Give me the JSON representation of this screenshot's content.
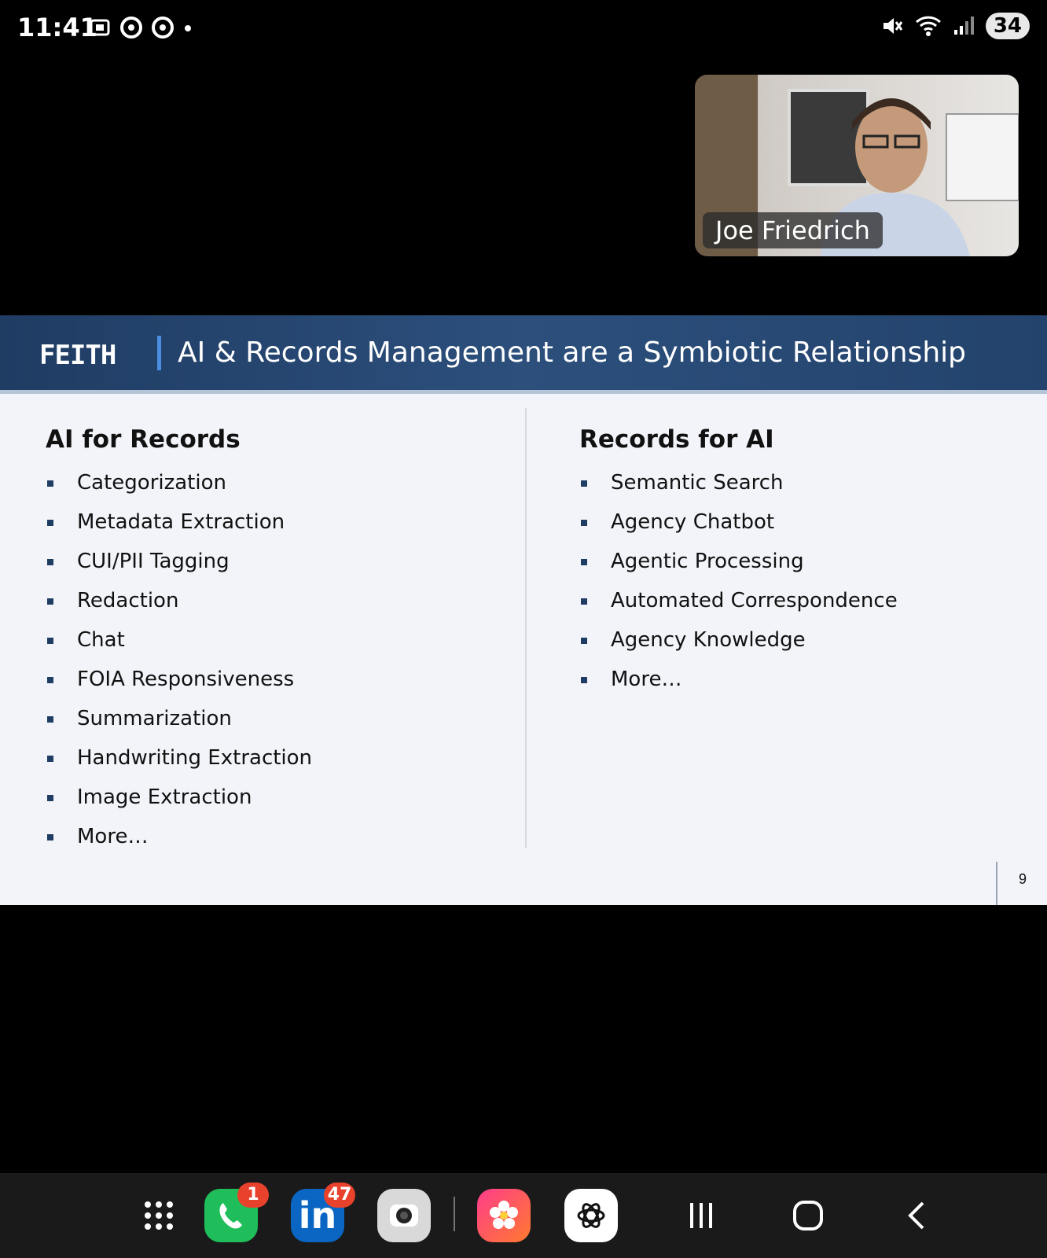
{
  "status_bar": {
    "time": "11:41",
    "battery": "34"
  },
  "video": {
    "participant_name": "Joe Friedrich"
  },
  "slide": {
    "logo_text": "FEITH",
    "title": "AI & Records Management are a Symbiotic Relationship",
    "left_heading": "AI for Records",
    "left_items": [
      "Categorization",
      "Metadata Extraction",
      "CUI/PII Tagging",
      "Redaction",
      "Chat",
      "FOIA Responsiveness",
      "Summarization",
      "Handwriting Extraction",
      "Image Extraction",
      "More…"
    ],
    "right_heading": "Records for AI",
    "right_items": [
      "Semantic Search",
      "Agency Chatbot",
      "Agentic Processing",
      "Automated Correspondence",
      "Agency Knowledge",
      "More…"
    ],
    "page_number": "9"
  },
  "dock": {
    "phone_badge": "1",
    "linkedin_badge": "47",
    "linkedin_label": "in"
  },
  "colors": {
    "header_bg": "#1f3c63",
    "slide_bg": "#f2f4f9",
    "accent": "#4a90e2"
  }
}
